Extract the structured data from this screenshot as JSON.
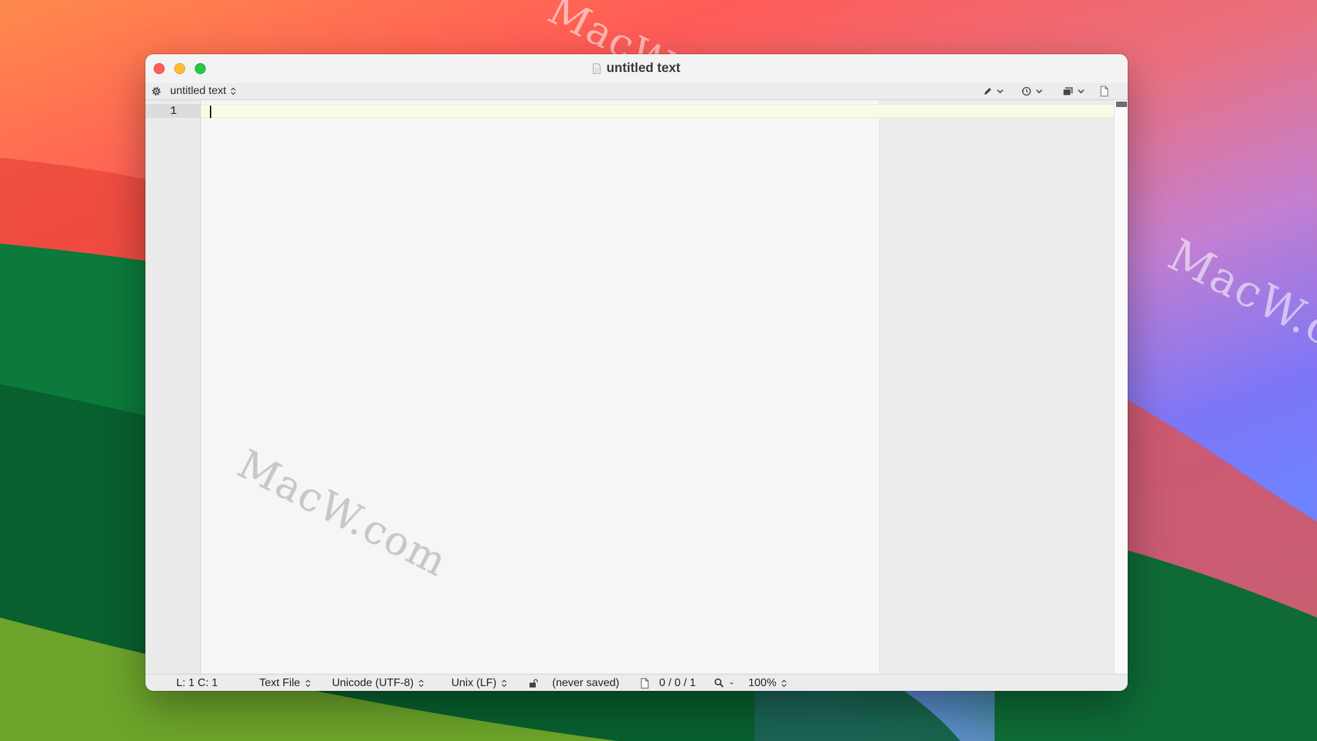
{
  "window": {
    "title": "untitled text"
  },
  "navbar": {
    "document_name": "untitled text"
  },
  "editor": {
    "line_numbers": [
      "1"
    ]
  },
  "statusbar": {
    "position": "L: 1 C: 1",
    "language": "Text File",
    "encoding": "Unicode (UTF-8)",
    "line_endings": "Unix (LF)",
    "save_status": "(never saved)",
    "counts": "0 / 0 / 1",
    "zoom_separator": "-",
    "zoom": "100%"
  },
  "watermarks": [
    "MacW.com",
    "MacW.c",
    "MacW.com"
  ],
  "colors": {
    "close": "#ff5f57",
    "minimize": "#febc2e",
    "maximize": "#28c840",
    "current_line": "#fafae6"
  },
  "icons": [
    "gear-icon",
    "document-icon",
    "pencil-icon",
    "clock-icon",
    "window-icon",
    "new-document-icon",
    "lock-icon",
    "magnifier-icon"
  ]
}
